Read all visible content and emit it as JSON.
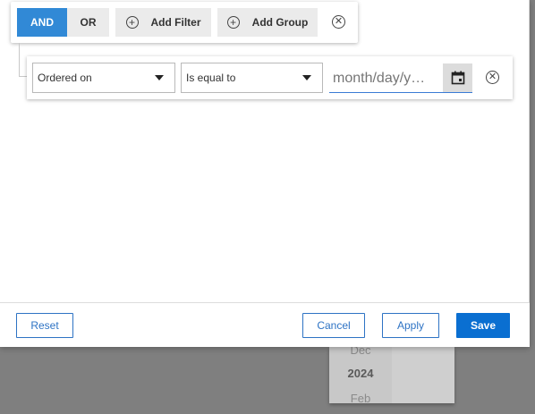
{
  "toolbar": {
    "and_label": "AND",
    "or_label": "OR",
    "add_filter_label": "Add Filter",
    "add_group_label": "Add Group",
    "plus_icon": "plus-circle-icon",
    "remove_icon": "close-circle-icon"
  },
  "filter": {
    "field_value": "Ordered on",
    "operator_value": "Is equal to",
    "date_placeholder": "month/day/y…",
    "calendar_icon": "calendar-icon",
    "remove_icon": "close-circle-icon"
  },
  "footer": {
    "reset_label": "Reset",
    "cancel_label": "Cancel",
    "apply_label": "Apply",
    "save_label": "Save"
  },
  "picker": {
    "items": [
      "Dec",
      "2024",
      "Feb"
    ]
  },
  "colors": {
    "accent": "#3189d6",
    "primary_button": "#0a6fd1",
    "outline": "#2e73c4"
  }
}
